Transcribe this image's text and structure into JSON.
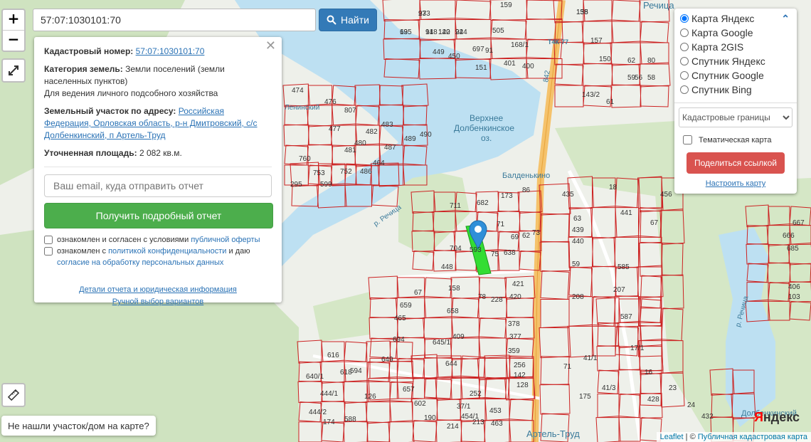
{
  "map": {
    "place_labels": {
      "rechitsa_top": "Речица",
      "lake": [
        "Верхнее",
        "Долбенкинское",
        "оз."
      ],
      "balden": "Балденькино",
      "river1": "р. Речица",
      "river2": "р. Речица",
      "artel": "Артель-Труд",
      "dolb": "Долбенкинский",
      "road": "Т4К-77",
      "road_km": "842",
      "lenin": "Ленинский"
    },
    "parcel_numbers": [
      "135",
      "273",
      "148",
      "140",
      "244",
      "138",
      "505",
      "159",
      "157",
      "449",
      "450",
      "697",
      "91",
      "168/1",
      "151",
      "401",
      "400",
      "62",
      "80",
      "59",
      "58",
      "143/2",
      "61",
      "150",
      "474",
      "476",
      "807",
      "483",
      "490",
      "477",
      "482",
      "481",
      "480",
      "487",
      "489",
      "464",
      "486",
      "760",
      "753",
      "752",
      "599",
      "295",
      "711",
      "682",
      "173",
      "86",
      "435",
      "18",
      "456",
      "71",
      "63",
      "439",
      "440",
      "441",
      "67",
      "593",
      "75",
      "638",
      "69",
      "62",
      "73",
      "704",
      "448",
      "59",
      "585",
      "158",
      "67",
      "659",
      "658",
      "465",
      "421",
      "420",
      "208",
      "207",
      "587",
      "17/1",
      "16",
      "616",
      "618",
      "649",
      "657",
      "602",
      "190",
      "214",
      "213",
      "463",
      "252",
      "37/1",
      "454/1",
      "453",
      "644",
      "645/1",
      "409",
      "694",
      "378",
      "377",
      "359",
      "256",
      "142",
      "128",
      "71",
      "41/1",
      "41/3",
      "175",
      "428",
      "23",
      "24",
      "432",
      "444/2",
      "444/1",
      "640/1",
      "594",
      "126",
      "588",
      "174",
      "667",
      "666",
      "685",
      "406",
      "103",
      "78",
      "228",
      "56",
      "69",
      "93",
      "91",
      "122",
      "92",
      "155"
    ],
    "selected_parcel_color": "#33dd33",
    "parcel_border_color": "#cc2222"
  },
  "zoom": {
    "in": "+",
    "out": "−"
  },
  "search": {
    "value": "57:07:1030101:70",
    "button_label": "Найти"
  },
  "info_panel": {
    "cadastral_label": "Кадастровый номер:",
    "cadastral_value": "57:07:1030101:70",
    "category_label": "Категория земель:",
    "category_value": "Земли поселений (земли населенных пунктов)",
    "category_use": "Для ведения личного подсобного хозяйства",
    "address_label": "Земельный участок по адресу:",
    "address_value": "Российская Федерация, Орловская область, р-н Дмитровский, с/с Долбенкинский, п Артель-Труд",
    "area_label": "Уточненная площадь:",
    "area_value": "2 082 кв.м.",
    "email_placeholder": "Ваш email, куда отправить отчет",
    "report_button": "Получить подробный отчет",
    "agree1_text": "ознакомлен и согласен с условиями ",
    "agree1_link": "публичной оферты",
    "agree2_text": "ознакомлен с ",
    "agree2_link": "политикой конфиденциальности",
    "agree2_text2": " и даю ",
    "agree2_link2": "согласие на обработку персональных данных",
    "details_link": "Детали отчета и юридическая информация",
    "manual_link": "Ручной выбор вариантов"
  },
  "layers": {
    "options": [
      "Карта Яндекс",
      "Карта Google",
      "Карта 2GIS",
      "Спутник Яндекс",
      "Спутник Google",
      "Спутник Bing"
    ],
    "selected": "Карта Яндекс",
    "overlay_select": "Кадастровые границы",
    "thematic_label": "Тематическая карта",
    "share_button": "Поделиться ссылкой",
    "setup_link": "Настроить карту"
  },
  "not_found_button": "Не нашли участок/дом на карте?",
  "attribution": {
    "leaflet": "Leaflet",
    "sep": " | © ",
    "pkk": "Публичная кадастровая карта"
  },
  "yandex_logo": {
    "y": "Я",
    "rest": "ндекс"
  }
}
